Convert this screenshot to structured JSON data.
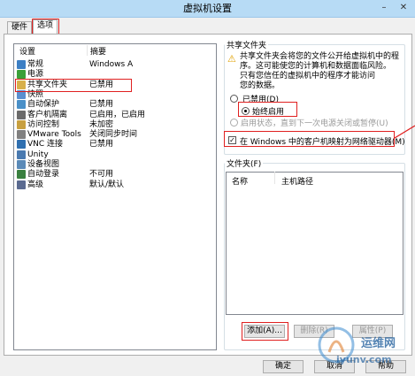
{
  "window": {
    "title": "虚拟机设置",
    "minimize": "–",
    "close": "✕"
  },
  "tabs": [
    {
      "label": "硬件"
    },
    {
      "label": "选项"
    }
  ],
  "list": {
    "col_setting": "设置",
    "col_summary": "摘要",
    "items": [
      {
        "name": "常规",
        "summary": "Windows A",
        "icon_color": "#3c7fc4"
      },
      {
        "name": "电源",
        "summary": "",
        "icon_color": "#3aa03a"
      },
      {
        "name": "共享文件夹",
        "summary": "已禁用",
        "icon_color": "#d8b04a"
      },
      {
        "name": "快照",
        "summary": "",
        "icon_color": "#5a8fd0"
      },
      {
        "name": "自动保护",
        "summary": "已禁用",
        "icon_color": "#4a90c8"
      },
      {
        "name": "客户机隔离",
        "summary": "已启用，已启用",
        "icon_color": "#6a6a6a"
      },
      {
        "name": "访问控制",
        "summary": "未加密",
        "icon_color": "#c8a040"
      },
      {
        "name": "VMware Tools",
        "summary": "关闭同步时间",
        "icon_color": "#808080"
      },
      {
        "name": "VNC 连接",
        "summary": "已禁用",
        "icon_color": "#3070b0"
      },
      {
        "name": "Unity",
        "summary": "",
        "icon_color": "#4a7ab0"
      },
      {
        "name": "设备视图",
        "summary": "",
        "icon_color": "#5a8ab8"
      },
      {
        "name": "自动登录",
        "summary": "不可用",
        "icon_color": "#3a8040"
      },
      {
        "name": "高级",
        "summary": "默认/默认",
        "icon_color": "#5a6a90"
      }
    ]
  },
  "shared": {
    "group_label": "共享文件夹",
    "warning_lines": [
      "共享文件夹会将您的文件公开给虚拟机中的程",
      "序。这可能使您的计算机和数据面临风险。",
      "只有您信任的虚拟机中的程序才能访问",
      "您的数据。"
    ],
    "warning_icon": "⚠",
    "opt_disabled": "已禁用(D)",
    "opt_always": "始终启用",
    "opt_until": "启用状态，直到下一次电源关闭或暂停(U)",
    "check_mark": "✓",
    "map_drive": "在 Windows 中的客户机映射为网络驱动器(M)"
  },
  "folders": {
    "group_label": "文件夹(F)",
    "col_name": "名称",
    "col_path": "主机路径",
    "add": "添加(A)...",
    "remove": "删除(R)",
    "properties": "属性(P)"
  },
  "footer": {
    "ok": "确定",
    "cancel": "取消",
    "help": "帮助"
  },
  "watermark": {
    "brand": "运维网",
    "url": "iyunv.com"
  }
}
